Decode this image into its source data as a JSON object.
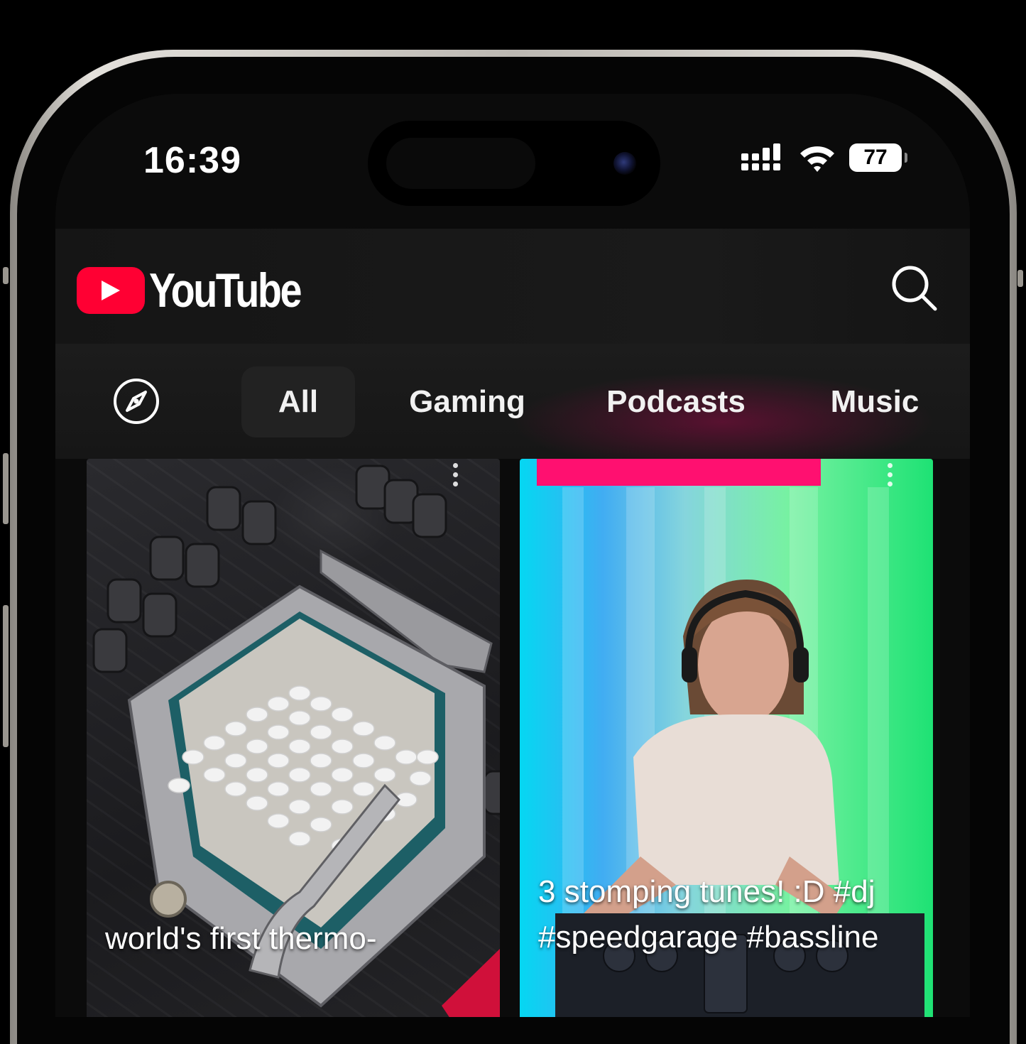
{
  "status_bar": {
    "time": "16:39",
    "battery": "77"
  },
  "header": {
    "logo_text": "YouTube",
    "brand_color": "#ff0033",
    "search_icon": "search-icon"
  },
  "chips": {
    "explore_icon": "compass-icon",
    "items": [
      {
        "label": "All",
        "selected": true
      },
      {
        "label": "Gaming",
        "selected": false
      },
      {
        "label": "Podcasts",
        "selected": false
      },
      {
        "label": "Music",
        "selected": false
      }
    ]
  },
  "feed": {
    "shorts": [
      {
        "title": "world's first thermo-"
      },
      {
        "title": "3 stomping tunes!  :D #dj #speedgarage #bassline"
      }
    ]
  }
}
